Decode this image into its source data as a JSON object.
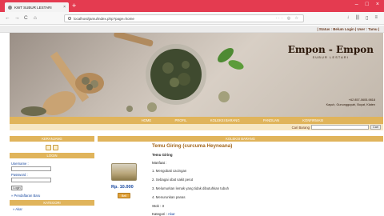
{
  "browser": {
    "tab_title": "KWT SUBUR LESTARI",
    "tab_close_icon": "close-icon",
    "new_tab_symbol": "+",
    "window_controls": [
      "–",
      "□",
      "×"
    ],
    "nav": {
      "back": "←",
      "forward": "→",
      "reload": "C",
      "home": "⌂"
    },
    "url": "localhost/jamu/index.php?page=home",
    "url_actions": "··· ◎ ☆",
    "toolbar": {
      "downloads": "↓",
      "library": "|||",
      "sidebar": "▯",
      "menu": "≡"
    }
  },
  "status": {
    "text": "| Status : Belum Login | User : Tamu |"
  },
  "banner": {
    "brand_title": "Empon - Empon",
    "brand_subtitle": "SUBUR LESTARI",
    "phone": "+62 857-0605-9818",
    "address": "Kayuh, Gunungguyah, Boyat, Klaten"
  },
  "menu": {
    "items": [
      "HOME",
      "PROFIL",
      "KOLEKSI BARANG",
      "PANDUAN",
      "KONFIRMASI"
    ]
  },
  "search": {
    "label": "Cari Barang",
    "button": "Cari"
  },
  "sidebar": {
    "keranjang_title": "KERANJANG",
    "login_title": "LOGIN",
    "username_label": "Username :",
    "password_label": "Password :",
    "login_button": "Login",
    "register_link": "» Pendaftaran Baru",
    "kategori_title": "KATEGORI",
    "categories": [
      "» Akar"
    ]
  },
  "main": {
    "section_title": "KOLEKSI BARANG",
    "product_title": "Temu Giring (curcuma Heyneana)",
    "product_subtitle": "Temu Giring",
    "khasiat_label": "Manfaat :",
    "benefits": [
      "1. Mengobati cacingan",
      "2. Sebagai obat sakit perut",
      "3. Melumurkan lemak yang tidak dibutuhkan tubuh",
      "4. Menurunkan panas"
    ],
    "stok": "Stok : 3",
    "kategori_label": "Kategori :",
    "kategori_value": "Akar",
    "price": "Rp. 10.000",
    "buy_button": "Beli"
  },
  "colors": {
    "tabbar": "#e43b50",
    "accent": "#e0b45b",
    "product_title": "#a3661c",
    "link": "#1a4aa0"
  }
}
